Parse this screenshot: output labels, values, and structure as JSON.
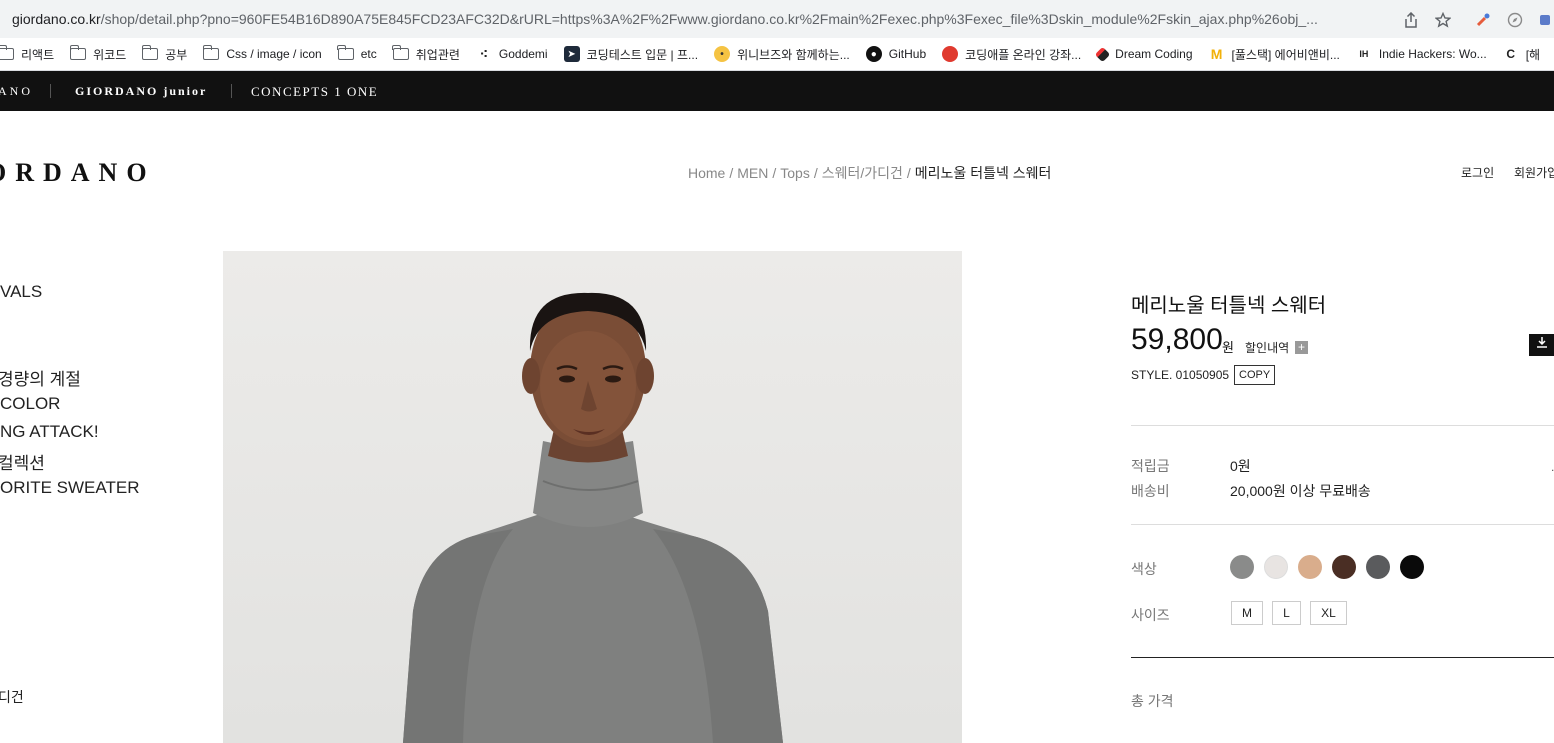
{
  "browser": {
    "url_domain": "giordano.co.kr",
    "url_path": "/shop/detail.php?pno=960FE54B16D890A75E845FCD23AFC32D&rURL=https%3A%2F%2Fwww.giordano.co.kr%2Fmain%2Fexec.php%3Fexec_file%3Dskin_module%2Fskin_ajax.php%26obj_...",
    "icons": [
      "share-icon",
      "star-icon",
      "eyedropper-icon",
      "compass-icon",
      "extension-icon"
    ]
  },
  "bookmarks": [
    {
      "label": "리액트",
      "icon": "folder-icon"
    },
    {
      "label": "위코드",
      "icon": "folder-icon"
    },
    {
      "label": "공부",
      "icon": "folder-icon"
    },
    {
      "label": "Css / image / icon",
      "icon": "folder-icon"
    },
    {
      "label": "etc",
      "icon": "folder-icon"
    },
    {
      "label": "취업관련",
      "icon": "folder-icon"
    },
    {
      "label": "Goddemi",
      "icon": "goddemi-icon"
    },
    {
      "label": "코딩테스트 입문 | 프...",
      "icon": "programmers-icon"
    },
    {
      "label": "위니브즈와 함께하는...",
      "icon": "weniv-icon"
    },
    {
      "label": "GitHub",
      "icon": "github-icon"
    },
    {
      "label": "코딩애플 온라인 강좌...",
      "icon": "apple-icon"
    },
    {
      "label": "Dream Coding",
      "icon": "dreamcoding-icon"
    },
    {
      "label": "[풀스택] 에어비앤비...",
      "icon": "mcdonalds-icon"
    },
    {
      "label": "Indie Hackers: Wo...",
      "icon": "ih-icon"
    },
    {
      "label": "[해",
      "icon": "c-icon"
    }
  ],
  "brandbar": {
    "brand1": "ANO",
    "brand2": "GIORDANO junior",
    "brand3": "CONCEPTS 1 ONE"
  },
  "header": {
    "logo": "ORDANO",
    "breadcrumb": [
      "Home",
      "MEN",
      "Tops",
      "스웨터/가디건",
      "메리노울 터틀넥 스웨터"
    ],
    "login": "로그인",
    "join": "회원가입"
  },
  "leftmenu": {
    "items": [
      "VALS",
      "경량의 계절",
      "COLOR",
      "NG ATTACK!",
      "컬렉션",
      "ORITE SWEATER",
      "디건"
    ]
  },
  "product": {
    "title": "메리노울 터틀넥 스웨터",
    "price": "59,800",
    "price_unit": "원",
    "discount_label": "할인내역",
    "plus": "+",
    "download_icon": "download-icon",
    "style_label": "STYLE. 01050905",
    "copy_label": "COPY",
    "points_label": "적립금",
    "points_value": "0원",
    "shipping_label": "배송비",
    "shipping_value": "20,000원 이상 무료배송",
    "color_label": "색상",
    "colors": [
      "#8a8b8a",
      "#e8e4e2",
      "#d9ad8c",
      "#4a2e24",
      "#5a5b5d",
      "#0a0a0a"
    ],
    "size_label": "사이즈",
    "sizes": [
      "M",
      "L",
      "XL"
    ],
    "total_label": "총 가격"
  }
}
